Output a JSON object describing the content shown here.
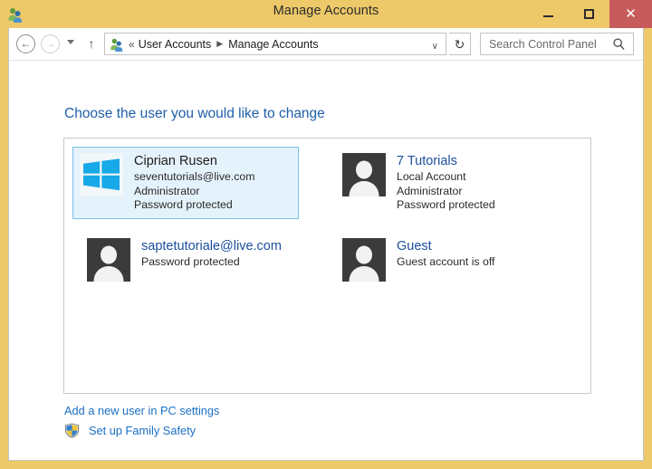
{
  "window": {
    "title": "Manage Accounts",
    "title_icon": "user-accounts-icon",
    "minimize_label": "–",
    "maximize_label": "□",
    "close_label": "✕",
    "frame_color": "#eec96a",
    "close_button_color": "#c75b5b"
  },
  "navbar": {
    "back_label": "←",
    "forward_label": "→",
    "recent_dropdown_label": "▾",
    "up_label": "↑",
    "address_icon": "user-accounts-icon",
    "breadcrumb_prefix": "«",
    "breadcrumbs": [
      {
        "label": "User Accounts"
      },
      {
        "label": "Manage Accounts"
      }
    ],
    "breadcrumb_separator": "▶",
    "address_dropdown_label": "∨",
    "refresh_label": "↻",
    "search": {
      "placeholder": "Search Control Panel",
      "value": "",
      "icon": "search-icon"
    }
  },
  "page": {
    "heading": "Choose the user you would like to change",
    "heading_color": "#1f5fa9"
  },
  "accounts": [
    {
      "name": "Ciprian Rusen",
      "lines": [
        "seventutorials@live.com",
        "Administrator",
        "Password protected"
      ],
      "avatar": "windows-logo-avatar",
      "selected": true
    },
    {
      "name": "7 Tutorials",
      "lines": [
        "Local Account",
        "Administrator",
        "Password protected"
      ],
      "avatar": "person-avatar",
      "selected": false
    },
    {
      "name": "saptetutoriale@live.com",
      "lines": [
        "Password protected"
      ],
      "avatar": "person-avatar",
      "selected": false
    },
    {
      "name": "Guest",
      "lines": [
        "Guest account is off"
      ],
      "avatar": "person-avatar",
      "selected": false
    }
  ],
  "footer": {
    "add_user_link": "Add a new user in PC settings",
    "family_safety_link": "Set up Family Safety",
    "family_safety_icon": "shield-icon",
    "link_color": "#1a6fc4"
  }
}
